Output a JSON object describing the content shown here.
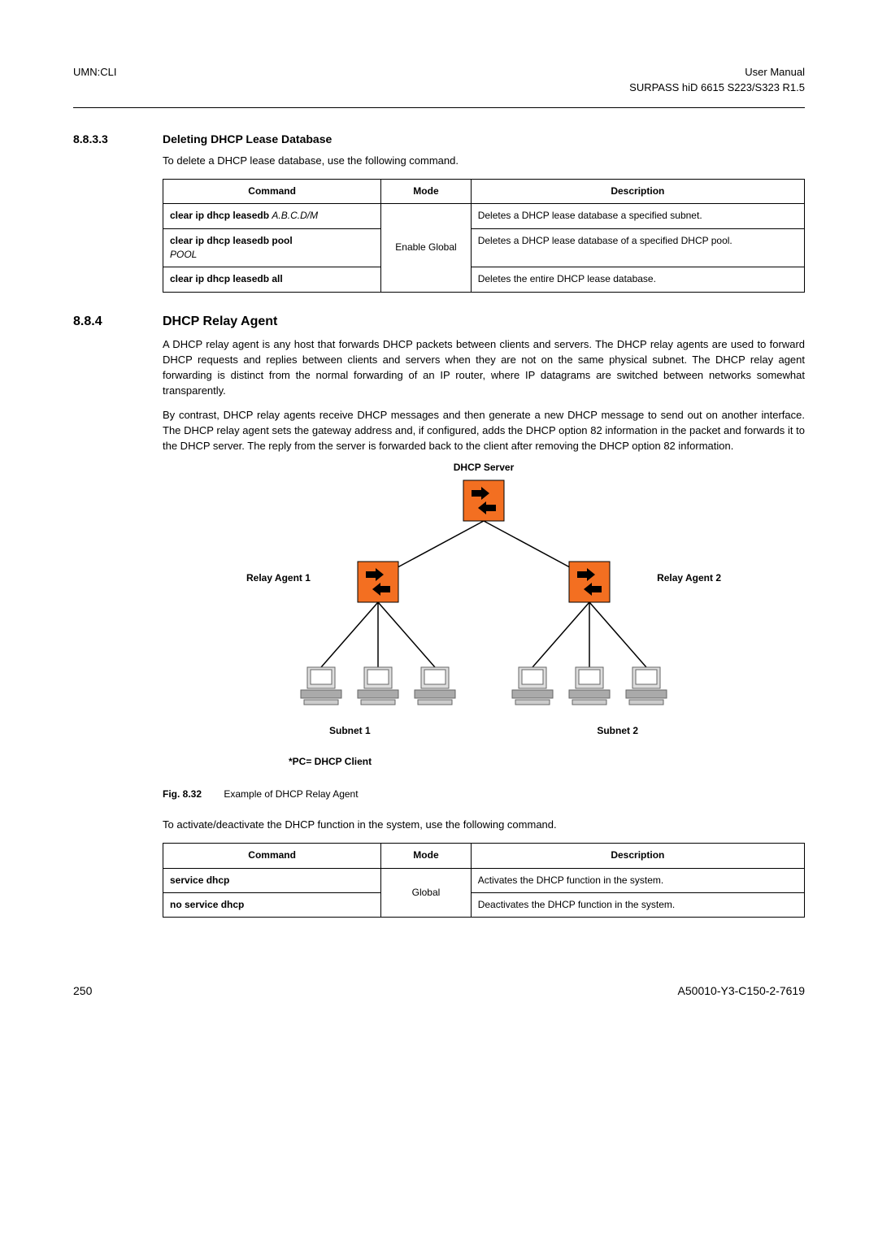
{
  "header": {
    "left": "UMN:CLI",
    "right_line1": "User Manual",
    "right_line2": "SURPASS hiD 6615 S223/S323 R1.5"
  },
  "section1": {
    "number": "8.8.3.3",
    "title": "Deleting DHCP Lease Database",
    "intro": "To delete a DHCP lease database, use the following command."
  },
  "table1": {
    "headers": {
      "command": "Command",
      "mode": "Mode",
      "description": "Description"
    },
    "mode_span": "Enable Global",
    "rows": [
      {
        "cmd_bold": "clear ip dhcp leasedb ",
        "cmd_italic": "A.B.C.D/M",
        "desc": "Deletes a DHCP lease database a specified subnet."
      },
      {
        "cmd_bold": "clear ip dhcp leasedb pool",
        "cmd_italic_line2": "POOL",
        "desc": "Deletes a DHCP lease database of a specified DHCP pool."
      },
      {
        "cmd_bold": "clear ip dhcp leasedb all",
        "desc": "Deletes the entire DHCP lease database."
      }
    ]
  },
  "section2": {
    "number": "8.8.4",
    "title": "DHCP Relay Agent",
    "p1": "A DHCP relay agent is any host that forwards DHCP packets between clients and servers. The DHCP relay agents are used to forward DHCP requests and replies between clients and servers when they are not on the same physical subnet. The DHCP relay agent forwarding is distinct from the normal forwarding of an IP router, where IP datagrams are switched between networks somewhat transparently.",
    "p2": "By contrast, DHCP relay agents receive DHCP messages and then generate a new DHCP message to send out on another interface. The DHCP relay agent sets the gateway address and, if configured, adds the DHCP option 82 information in the packet and forwards it to the DHCP server. The reply from the server is forwarded back to the client after removing the DHCP option 82 information."
  },
  "diagram": {
    "dhcp_server": "DHCP Server",
    "relay1": "Relay Agent 1",
    "relay2": "Relay Agent 2",
    "subnet1": "Subnet 1",
    "subnet2": "Subnet 2",
    "note": "*PC= DHCP Client"
  },
  "fig": {
    "number": "Fig. 8.32",
    "caption": "Example of DHCP Relay Agent"
  },
  "table2_intro": "To activate/deactivate the DHCP function in the system, use the following command.",
  "table2": {
    "headers": {
      "command": "Command",
      "mode": "Mode",
      "description": "Description"
    },
    "mode_span": "Global",
    "rows": [
      {
        "cmd_bold": "service dhcp",
        "desc": "Activates the DHCP function in the system."
      },
      {
        "cmd_bold": "no service dhcp",
        "desc": "Deactivates the DHCP function in the system."
      }
    ]
  },
  "footer": {
    "page": "250",
    "doc": "A50010-Y3-C150-2-7619"
  }
}
